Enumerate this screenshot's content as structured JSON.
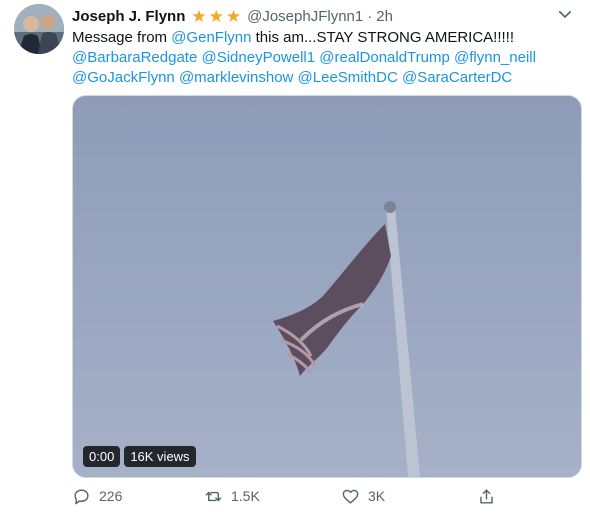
{
  "tweet": {
    "author_name": "Joseph J. Flynn",
    "stars": [
      "star",
      "star",
      "star"
    ],
    "handle": "@JosephJFlynn1",
    "separator": "·",
    "time": "2h",
    "text_prefix": "Message from ",
    "mention_genflynn": "@GenFlynn",
    "text_suffix": " this am...STAY STRONG AMERICA!!!!!",
    "mentions_line2": [
      "@BarbaraRedgate",
      "@SidneyPowell1",
      "@realDonaldTrump",
      "@flynn_neill"
    ],
    "mentions_line3": [
      "@GoJackFlynn",
      "@marklevinshow",
      "@LeeSmithDC",
      "@SaraCarterDC"
    ]
  },
  "media": {
    "timestamp": "0:00",
    "views": "16K views"
  },
  "actions": {
    "reply_count": "226",
    "retweet_count": "1.5K",
    "like_count": "3K"
  },
  "colors": {
    "link": "#1b95e0",
    "star": "#f5a623",
    "muted": "#536471"
  }
}
